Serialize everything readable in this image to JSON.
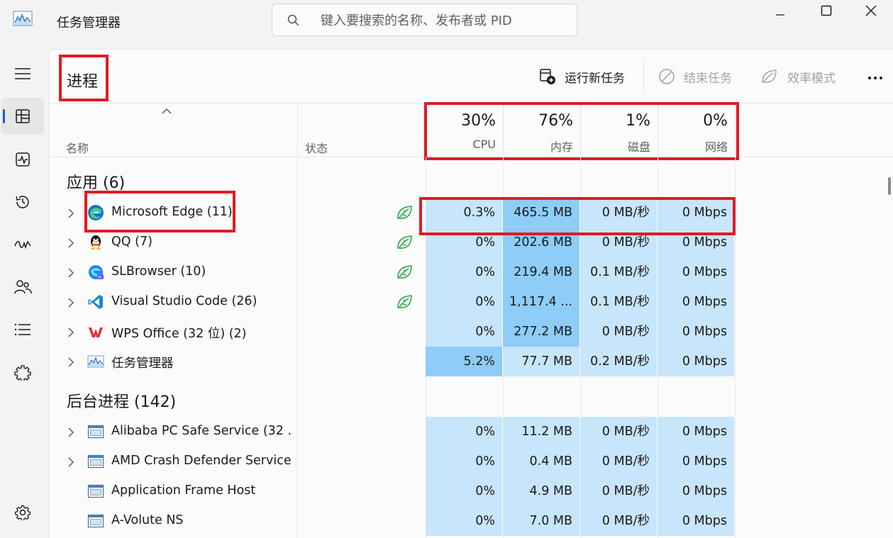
{
  "window": {
    "title": "任务管理器",
    "search_placeholder": "键入要搜索的名称、发布者或 PID"
  },
  "nav": {
    "items": [
      "menu-icon",
      "processes-icon",
      "performance-icon",
      "app-history-icon",
      "startup-icon",
      "users-icon",
      "details-icon",
      "services-icon"
    ],
    "settings": "gear-icon",
    "active": "processes-icon"
  },
  "toolbar": {
    "page_title": "进程",
    "run_new_task": "运行新任务",
    "end_task": "结束任务",
    "efficiency_mode": "效率模式"
  },
  "columns": {
    "name": "名称",
    "status": "状态",
    "metrics": [
      {
        "pct": "30%",
        "label": "CPU"
      },
      {
        "pct": "76%",
        "label": "内存"
      },
      {
        "pct": "1%",
        "label": "磁盘"
      },
      {
        "pct": "0%",
        "label": "网络"
      }
    ]
  },
  "groups": {
    "apps": {
      "title": "应用 (6)",
      "rows": [
        {
          "name": "Microsoft Edge (11)",
          "icon": "edge-icon",
          "efficiency": true,
          "expandable": true,
          "cpu": "0.3%",
          "mem": "465.5 MB",
          "disk": "0 MB/秒",
          "net": "0 Mbps",
          "cpu_hot": false,
          "mem_hot": true
        },
        {
          "name": "QQ (7)",
          "icon": "qq-icon",
          "efficiency": true,
          "expandable": true,
          "cpu": "0%",
          "mem": "202.6 MB",
          "disk": "0 MB/秒",
          "net": "0 Mbps",
          "cpu_hot": false,
          "mem_hot": true
        },
        {
          "name": "SLBrowser (10)",
          "icon": "slbrowser-icon",
          "efficiency": true,
          "expandable": true,
          "cpu": "0%",
          "mem": "219.4 MB",
          "disk": "0.1 MB/秒",
          "net": "0 Mbps",
          "cpu_hot": false,
          "mem_hot": true
        },
        {
          "name": "Visual Studio Code (26)",
          "icon": "vscode-icon",
          "efficiency": true,
          "expandable": true,
          "cpu": "0%",
          "mem": "1,117.4 ...",
          "disk": "0.1 MB/秒",
          "net": "0 Mbps",
          "cpu_hot": false,
          "mem_hot": true
        },
        {
          "name": "WPS Office (32 位) (2)",
          "icon": "wps-icon",
          "efficiency": false,
          "expandable": true,
          "cpu": "0%",
          "mem": "277.2 MB",
          "disk": "0 MB/秒",
          "net": "0 Mbps",
          "cpu_hot": false,
          "mem_hot": true
        },
        {
          "name": "任务管理器",
          "icon": "task-manager-icon",
          "efficiency": false,
          "expandable": true,
          "cpu": "5.2%",
          "mem": "77.7 MB",
          "disk": "0.2 MB/秒",
          "net": "0 Mbps",
          "cpu_hot": true,
          "mem_hot": false
        }
      ]
    },
    "background": {
      "title": "后台进程 (142)",
      "rows": [
        {
          "name": "Alibaba PC Safe Service (32 ...",
          "icon": "service-window-icon",
          "efficiency": false,
          "expandable": true,
          "cpu": "0%",
          "mem": "11.2 MB",
          "disk": "0 MB/秒",
          "net": "0 Mbps",
          "cpu_hot": false,
          "mem_hot": false
        },
        {
          "name": "AMD Crash Defender Service",
          "icon": "service-window-icon",
          "efficiency": false,
          "expandable": true,
          "cpu": "0%",
          "mem": "0.4 MB",
          "disk": "0 MB/秒",
          "net": "0 Mbps",
          "cpu_hot": false,
          "mem_hot": false
        },
        {
          "name": "Application Frame Host",
          "icon": "service-window-icon",
          "efficiency": false,
          "expandable": false,
          "cpu": "0%",
          "mem": "4.9 MB",
          "disk": "0 MB/秒",
          "net": "0 Mbps",
          "cpu_hot": false,
          "mem_hot": false
        },
        {
          "name": "A-Volute NS",
          "icon": "service-window-icon",
          "efficiency": false,
          "expandable": false,
          "cpu": "0%",
          "mem": "7.0 MB",
          "disk": "0 MB/秒",
          "net": "0 Mbps",
          "cpu_hot": false,
          "mem_hot": false
        }
      ]
    }
  },
  "colors": {
    "cell": "#c7e5fb",
    "cell_hot": "#8ecdf8",
    "highlight_box": "#e01b24",
    "accent": "#1f5fbf",
    "efficiency_leaf": "#2e9e4a"
  }
}
